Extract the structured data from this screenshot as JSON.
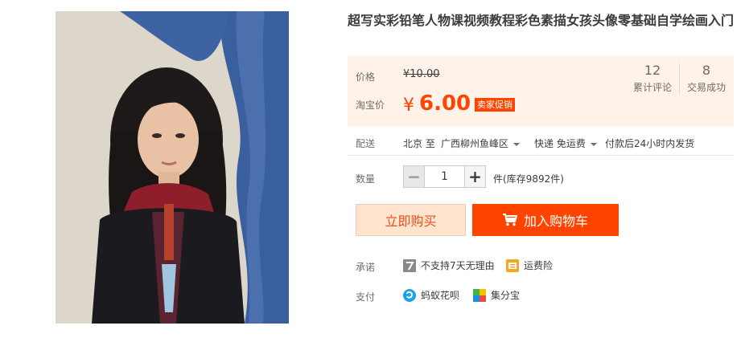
{
  "product": {
    "title": "超写实彩铅笔人物课视频教程彩色素描女孩头像零基础自学绘画入门",
    "image_alt": "彩铅人物画作：黑发女孩站在蓝色布帘旁"
  },
  "price": {
    "label": "价格",
    "original": "¥10.00",
    "taobao_label": "淘宝价",
    "currency": "¥",
    "current": "6.00",
    "promo_badge": "卖家促销",
    "accent_color": "#ff4400"
  },
  "stats": [
    {
      "value": "12",
      "label": "累计评论"
    },
    {
      "value": "8",
      "label": "交易成功"
    }
  ],
  "shipping": {
    "label": "配送",
    "from": "北京 至",
    "to": "广西柳州鱼峰区",
    "method": "快递 免运费",
    "dispatch": "付款后24小时内发货"
  },
  "quantity": {
    "label": "数量",
    "value": "1",
    "minus": "−",
    "plus": "+",
    "stock": "件(库存9892件)"
  },
  "actions": {
    "buy_now": "立即购买",
    "add_to_cart": "加入购物车"
  },
  "promise": {
    "label": "承诺",
    "items": [
      {
        "icon": "seven-day-icon",
        "text": "不支持7天无理由"
      },
      {
        "icon": "shipping-insurance-icon",
        "text": "运费险"
      }
    ]
  },
  "payment": {
    "label": "支付",
    "items": [
      {
        "icon": "huabei-icon",
        "text": "蚂蚁花呗"
      },
      {
        "icon": "jifenbao-icon",
        "text": "集分宝"
      }
    ]
  }
}
